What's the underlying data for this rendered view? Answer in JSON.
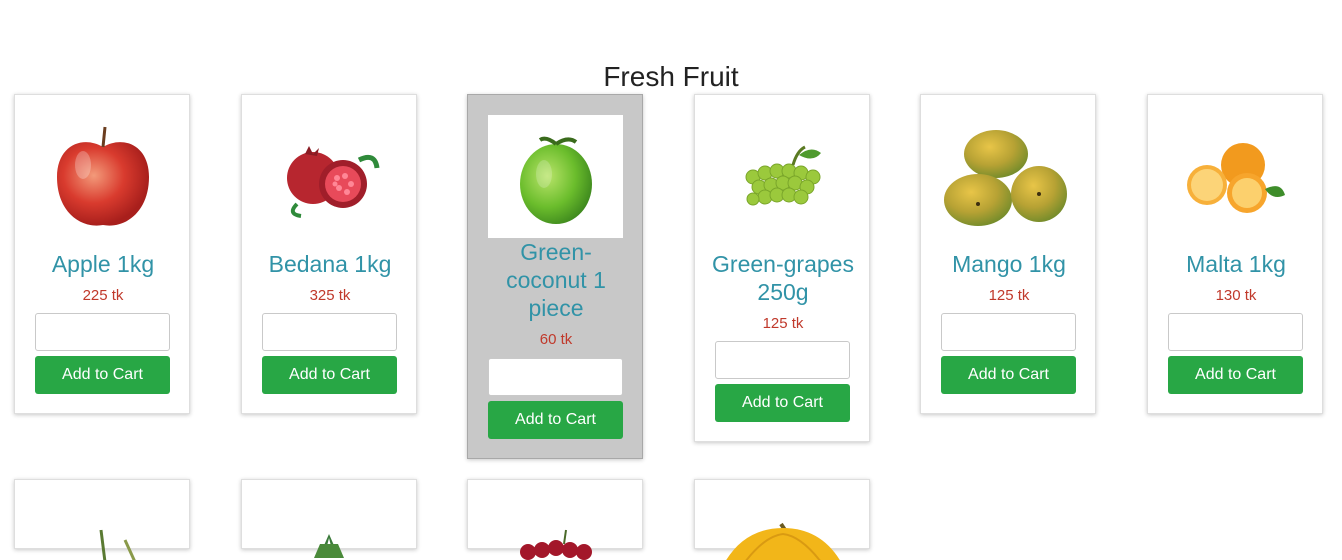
{
  "page": {
    "title": "Fresh Fruit"
  },
  "products": [
    {
      "name": "Apple 1kg",
      "price": "225 tk",
      "button": "Add to Cart",
      "icon": "apple-icon"
    },
    {
      "name": "Bedana 1kg",
      "price": "325 tk",
      "button": "Add to Cart",
      "icon": "pomegranate-icon"
    },
    {
      "name": "Green-coconut 1 piece",
      "price": "60 tk",
      "button": "Add to Cart",
      "icon": "coconut-icon"
    },
    {
      "name": "Green-grapes 250g",
      "price": "125 tk",
      "button": "Add to Cart",
      "icon": "grapes-icon"
    },
    {
      "name": "Mango 1kg",
      "price": "125 tk",
      "button": "Add to Cart",
      "icon": "mango-icon"
    },
    {
      "name": "Malta 1kg",
      "price": "130 tk",
      "button": "Add to Cart",
      "icon": "orange-icon"
    }
  ],
  "products_partial": [
    {
      "icon": "sugarcane-icon"
    },
    {
      "icon": "pineapple-icon"
    },
    {
      "icon": "cherry-icon"
    },
    {
      "icon": "banana-icon"
    }
  ]
}
